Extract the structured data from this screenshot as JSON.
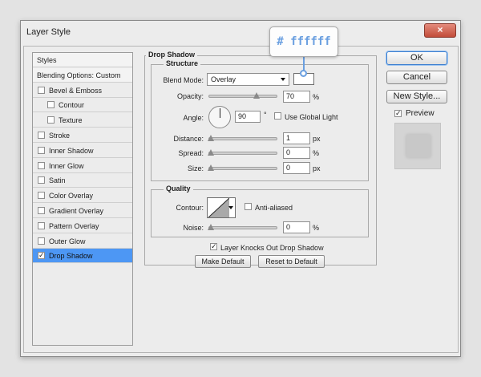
{
  "window": {
    "title": "Layer Style",
    "close_label": "×"
  },
  "sidebar": {
    "items": [
      {
        "label": "Styles",
        "type": "header"
      },
      {
        "label": "Blending Options: Custom",
        "type": "header"
      },
      {
        "label": "Bevel & Emboss",
        "checked": false
      },
      {
        "label": "Contour",
        "checked": false,
        "indent": true
      },
      {
        "label": "Texture",
        "checked": false,
        "indent": true
      },
      {
        "label": "Stroke",
        "checked": false
      },
      {
        "label": "Inner Shadow",
        "checked": false
      },
      {
        "label": "Inner Glow",
        "checked": false
      },
      {
        "label": "Satin",
        "checked": false
      },
      {
        "label": "Color Overlay",
        "checked": false
      },
      {
        "label": "Gradient Overlay",
        "checked": false
      },
      {
        "label": "Pattern Overlay",
        "checked": false
      },
      {
        "label": "Outer Glow",
        "checked": false
      },
      {
        "label": "Drop Shadow",
        "checked": true,
        "selected": true
      }
    ]
  },
  "panel": {
    "title": "Drop Shadow",
    "structure": {
      "title": "Structure",
      "blend_mode_label": "Blend Mode:",
      "blend_mode_value": "Overlay",
      "color": "#ffffff",
      "opacity_label": "Opacity:",
      "opacity_value": "70",
      "opacity_fraction": 0.7,
      "opacity_unit": "%",
      "angle_label": "Angle:",
      "angle_value": "90",
      "angle_unit": "°",
      "use_global_light_label": "Use Global Light",
      "use_global_light": false,
      "distance_label": "Distance:",
      "distance_value": "1",
      "distance_unit": "px",
      "spread_label": "Spread:",
      "spread_value": "0",
      "spread_unit": "%",
      "size_label": "Size:",
      "size_value": "0",
      "size_unit": "px"
    },
    "quality": {
      "title": "Quality",
      "contour_label": "Contour:",
      "anti_aliased_label": "Anti-aliased",
      "anti_aliased": false,
      "noise_label": "Noise:",
      "noise_value": "0",
      "noise_unit": "%"
    },
    "knockout_label": "Layer Knocks Out Drop Shadow",
    "knockout": true,
    "make_default_label": "Make Default",
    "reset_default_label": "Reset to Default"
  },
  "actions": {
    "ok_label": "OK",
    "cancel_label": "Cancel",
    "new_style_label": "New Style...",
    "preview_label": "Preview",
    "preview_checked": true
  },
  "callout": {
    "text": "# ffffff"
  },
  "colors": {
    "selection": "#4d97f4",
    "ok_border": "#3c7fd0",
    "callout_text": "#6a9fe0"
  }
}
